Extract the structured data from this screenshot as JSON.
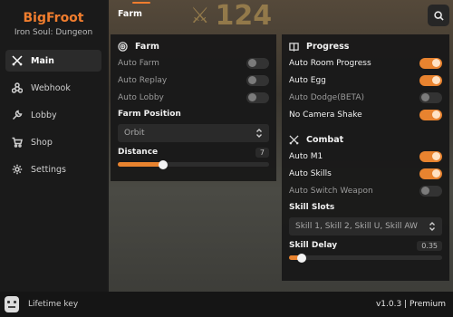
{
  "brand": {
    "title": "BigFroot",
    "subtitle": "Iron Soul: Dungeon"
  },
  "game_hud": {
    "counter": "124"
  },
  "sidebar": {
    "items": [
      {
        "label": "Main",
        "icon": "crossed-swords-icon",
        "active": true
      },
      {
        "label": "Webhook",
        "icon": "webhook-icon",
        "active": false
      },
      {
        "label": "Lobby",
        "icon": "wrench-icon",
        "active": false
      },
      {
        "label": "Shop",
        "icon": "cart-icon",
        "active": false
      },
      {
        "label": "Settings",
        "icon": "gear-icon",
        "active": false
      }
    ]
  },
  "topbar": {
    "tab": "Farm",
    "search_icon": "search-icon"
  },
  "farm": {
    "title": "Farm",
    "toggles": [
      {
        "label": "Auto Farm",
        "on": false
      },
      {
        "label": "Auto Replay",
        "on": false
      },
      {
        "label": "Auto Lobby",
        "on": false
      }
    ],
    "position_label": "Farm Position",
    "position_value": "Orbit",
    "distance_label": "Distance",
    "distance_value": "7",
    "distance_fraction": 0.3
  },
  "progress": {
    "title": "Progress",
    "toggles": [
      {
        "label": "Auto Room Progress",
        "on": true
      },
      {
        "label": "Auto Egg",
        "on": true
      },
      {
        "label": "Auto Dodge(BETA)",
        "on": false
      },
      {
        "label": "No Camera Shake",
        "on": true
      }
    ]
  },
  "combat": {
    "title": "Combat",
    "toggles": [
      {
        "label": "Auto M1",
        "on": true
      },
      {
        "label": "Auto Skills",
        "on": true
      },
      {
        "label": "Auto Switch Weapon",
        "on": false
      }
    ],
    "slots_label": "Skill Slots",
    "slots_value": "Skill 1, Skill 2, Skill U, Skill AW",
    "delay_label": "Skill Delay",
    "delay_value": "0.35",
    "delay_fraction": 0.08
  },
  "footer": {
    "key_label": "Lifetime key",
    "version": "v1.0.3 | Premium"
  },
  "colors": {
    "accent": "#e8832f",
    "brand": "#f07d2e",
    "panel": "#191919"
  }
}
